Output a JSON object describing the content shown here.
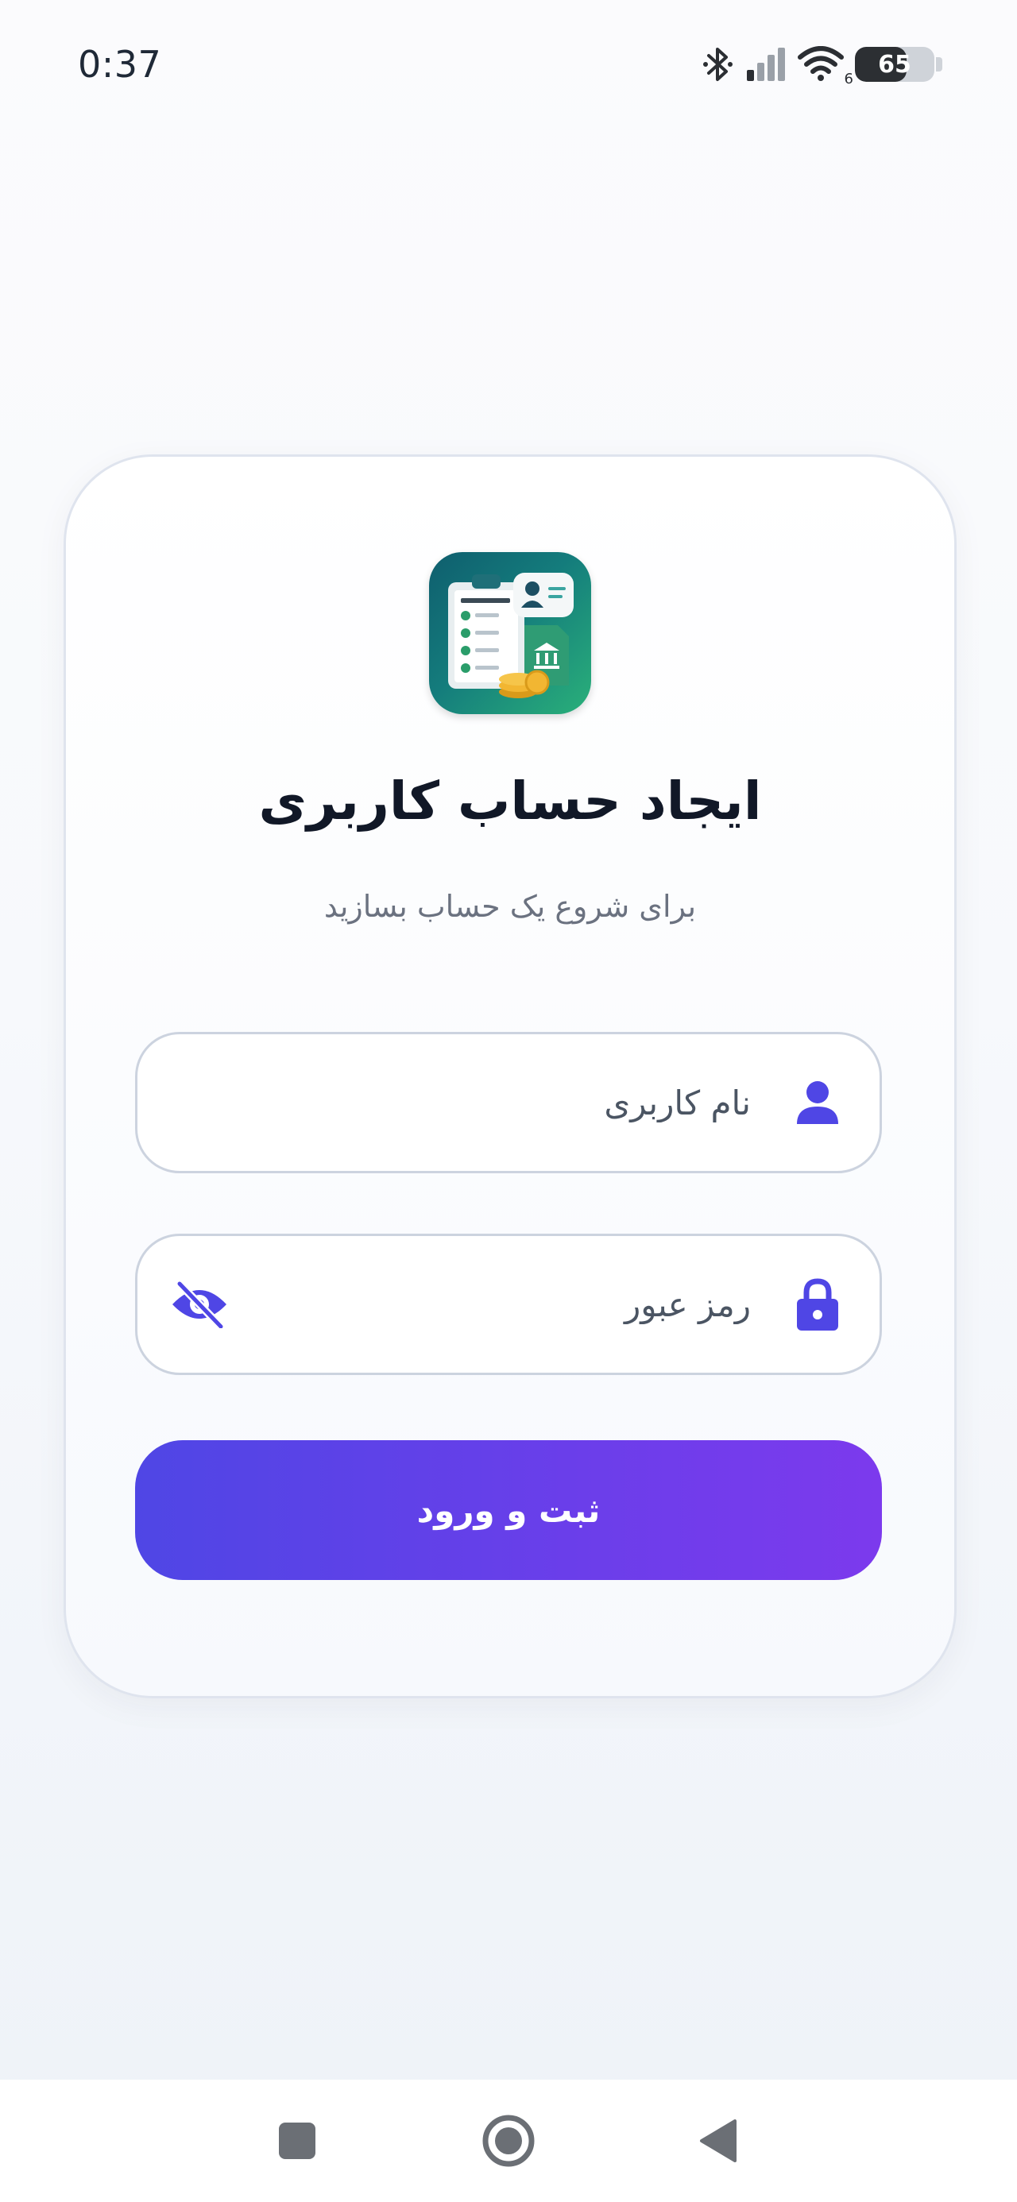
{
  "status_bar": {
    "time": "0:37",
    "battery_percent": 65,
    "battery_label": "65",
    "wifi_badge": "6",
    "icons": [
      "bluetooth-icon",
      "cellular-signal-icon",
      "wifi-icon",
      "battery-icon"
    ]
  },
  "card": {
    "logo_icon": "installment-management-app-icon",
    "title": "ایجاد حساب کاربری",
    "subtitle": "برای شروع یک حساب بسازید"
  },
  "form": {
    "username": {
      "placeholder": "نام کاربری",
      "value": "",
      "icon": "user-icon"
    },
    "password": {
      "placeholder": "رمز عبور",
      "value": "",
      "icon": "lock-icon",
      "toggle_icon": "eye-off-icon"
    },
    "submit_label": "ثبت و ورود"
  },
  "navigation_bar": {
    "icons": [
      "recents-square-icon",
      "home-circle-icon",
      "back-triangle-icon"
    ]
  },
  "colors": {
    "accent": "#4f46e5",
    "accent_end": "#7c3aed",
    "title": "#111827",
    "subtitle": "#6b7280",
    "field_border": "#ccd3df"
  }
}
